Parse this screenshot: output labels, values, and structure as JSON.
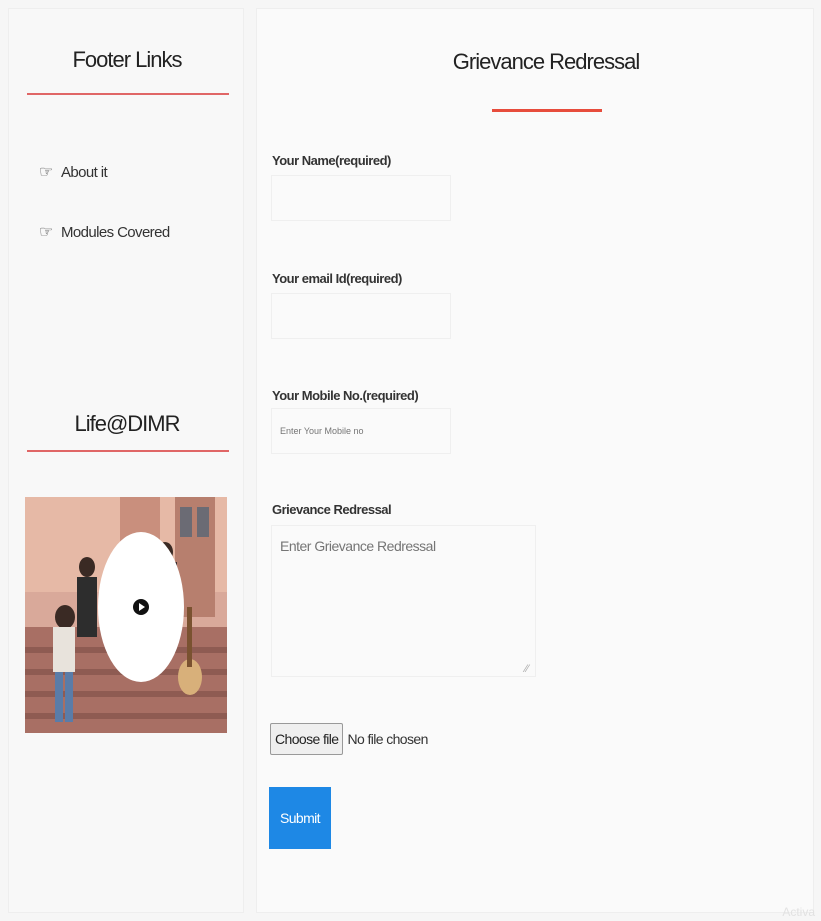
{
  "sidebar": {
    "footer_heading": "Footer Links",
    "links": [
      {
        "label": "About it",
        "icon": "hand-pointer-icon"
      },
      {
        "label": "Modules Covered",
        "icon": "hand-pointer-icon"
      }
    ],
    "life_heading": "Life@DIMR",
    "video": {
      "icon": "play-icon"
    }
  },
  "form": {
    "heading": "Grievance Redressal",
    "name_label": "Your Name(required)",
    "name_value": "",
    "email_label": "Your email Id(required)",
    "email_value": "",
    "mobile_label": "Your Mobile No.(required)",
    "mobile_placeholder": "Enter Your Mobile no",
    "grievance_label": "Grievance Redressal",
    "grievance_placeholder": "Enter Grievance Redressal",
    "file_button": "Choose file",
    "file_status": "No file chosen",
    "submit_label": "Submit"
  },
  "watermark": "Activa",
  "colors": {
    "accent_rule": "#e74c3c",
    "submit_bg": "#1e88e5"
  }
}
